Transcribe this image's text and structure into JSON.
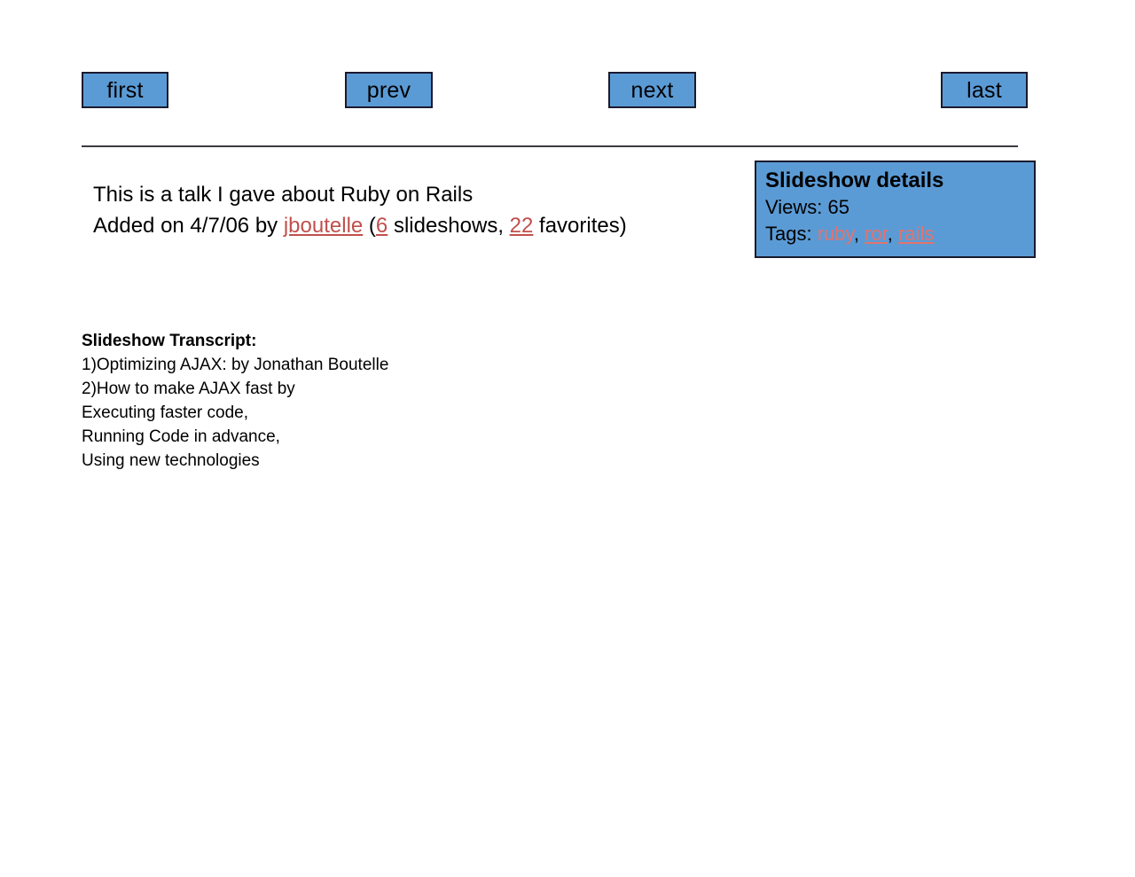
{
  "nav": {
    "buttons": [
      {
        "label": "first",
        "name": "first-button"
      },
      {
        "label": "prev",
        "name": "prev-button"
      },
      {
        "label": "next",
        "name": "next-button"
      },
      {
        "label": "last",
        "name": "last-button"
      }
    ]
  },
  "description": {
    "line1": "This is a talk I gave about Ruby on Rails",
    "line2_prefix": "Added on 4/7/06 by ",
    "author_link": "jboutelle",
    "open_paren": " (",
    "slideshow_count": "6",
    "slideshows_label": " slideshows, ",
    "favorites_count": "22",
    "favorites_label": " favorites)"
  },
  "details": {
    "title": "Slideshow details",
    "views_label": "Views: ",
    "views_value": "65",
    "tags_label": "Tags: ",
    "tags": [
      {
        "name": "ruby",
        "underlined": false
      },
      {
        "name": "ror",
        "underlined": true
      },
      {
        "name": "rails",
        "underlined": true
      }
    ],
    "tag_separator": ", "
  },
  "transcript": {
    "heading": "Slideshow Transcript:",
    "lines": [
      "1)Optimizing AJAX: by Jonathan Boutelle",
      "2)How to make AJAX fast by",
      "Executing faster code,",
      "Running Code in advance,",
      "Using new technologies"
    ]
  },
  "colors": {
    "accent_blue": "#5B9BD5",
    "border_dark": "#1a1a2e",
    "link_red": "#C0504D",
    "tag_red": "#E2736E",
    "rule": "#3b3b41"
  }
}
